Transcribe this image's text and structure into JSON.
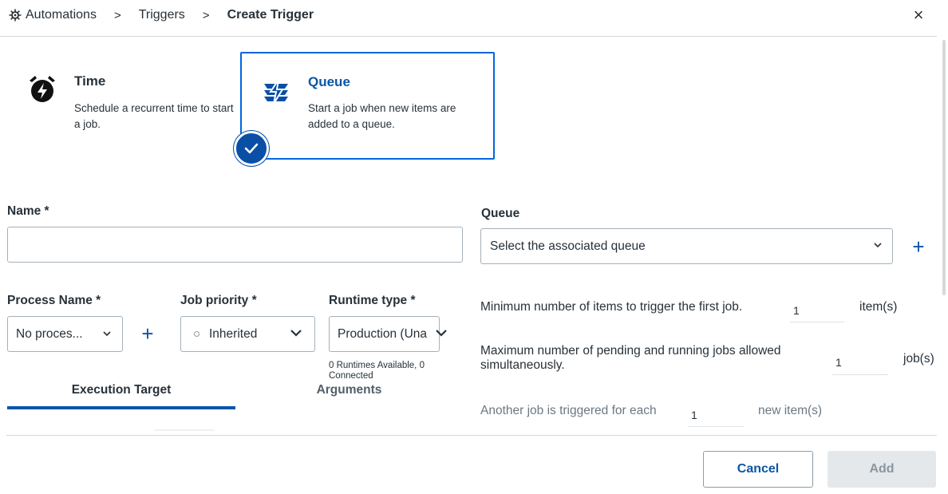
{
  "breadcrumb": {
    "items": [
      "Automations",
      "Triggers",
      "Create Trigger"
    ],
    "separator": ">"
  },
  "header": {
    "close_glyph": "×"
  },
  "trigger_types": {
    "time": {
      "title": "Time",
      "description": "Schedule a recurrent time to start a job.",
      "icon": "alarm-clock-icon"
    },
    "queue": {
      "title": "Queue",
      "description": "Start a job when new items are added to a queue.",
      "icon": "queue-icon",
      "selected": true
    }
  },
  "form": {
    "name": {
      "label": "Name *",
      "value": "",
      "placeholder": ""
    },
    "queue": {
      "label": "Queue",
      "value": "Select the associated queue",
      "add_glyph": "+"
    },
    "process_name": {
      "label": "Process Name *",
      "value": "No proces...",
      "add_glyph": "+"
    },
    "job_priority": {
      "label": "Job priority *",
      "value": "Inherited"
    },
    "runtime_type": {
      "label": "Runtime type *",
      "value": "Production (Una",
      "note": "0 Runtimes Available, 0 Connected"
    },
    "min_items": {
      "label": "Minimum number of items to trigger the first job.",
      "value": "1",
      "unit": "item(s)"
    },
    "max_jobs": {
      "label": "Maximum number of pending and running jobs allowed simultaneously.",
      "value": "1",
      "unit": "job(s)"
    },
    "another_job": {
      "label": "Another job is triggered for each",
      "value": "1",
      "unit": "new item(s)"
    }
  },
  "tabs": [
    {
      "label": "Execution Target",
      "active": true
    },
    {
      "label": "Arguments",
      "active": false
    }
  ],
  "footer": {
    "cancel_label": "Cancel",
    "add_label": "Add"
  },
  "colors": {
    "accent": "#0a56a6",
    "selected_border": "#0067df",
    "disabled_bg": "#e4e8eb"
  }
}
